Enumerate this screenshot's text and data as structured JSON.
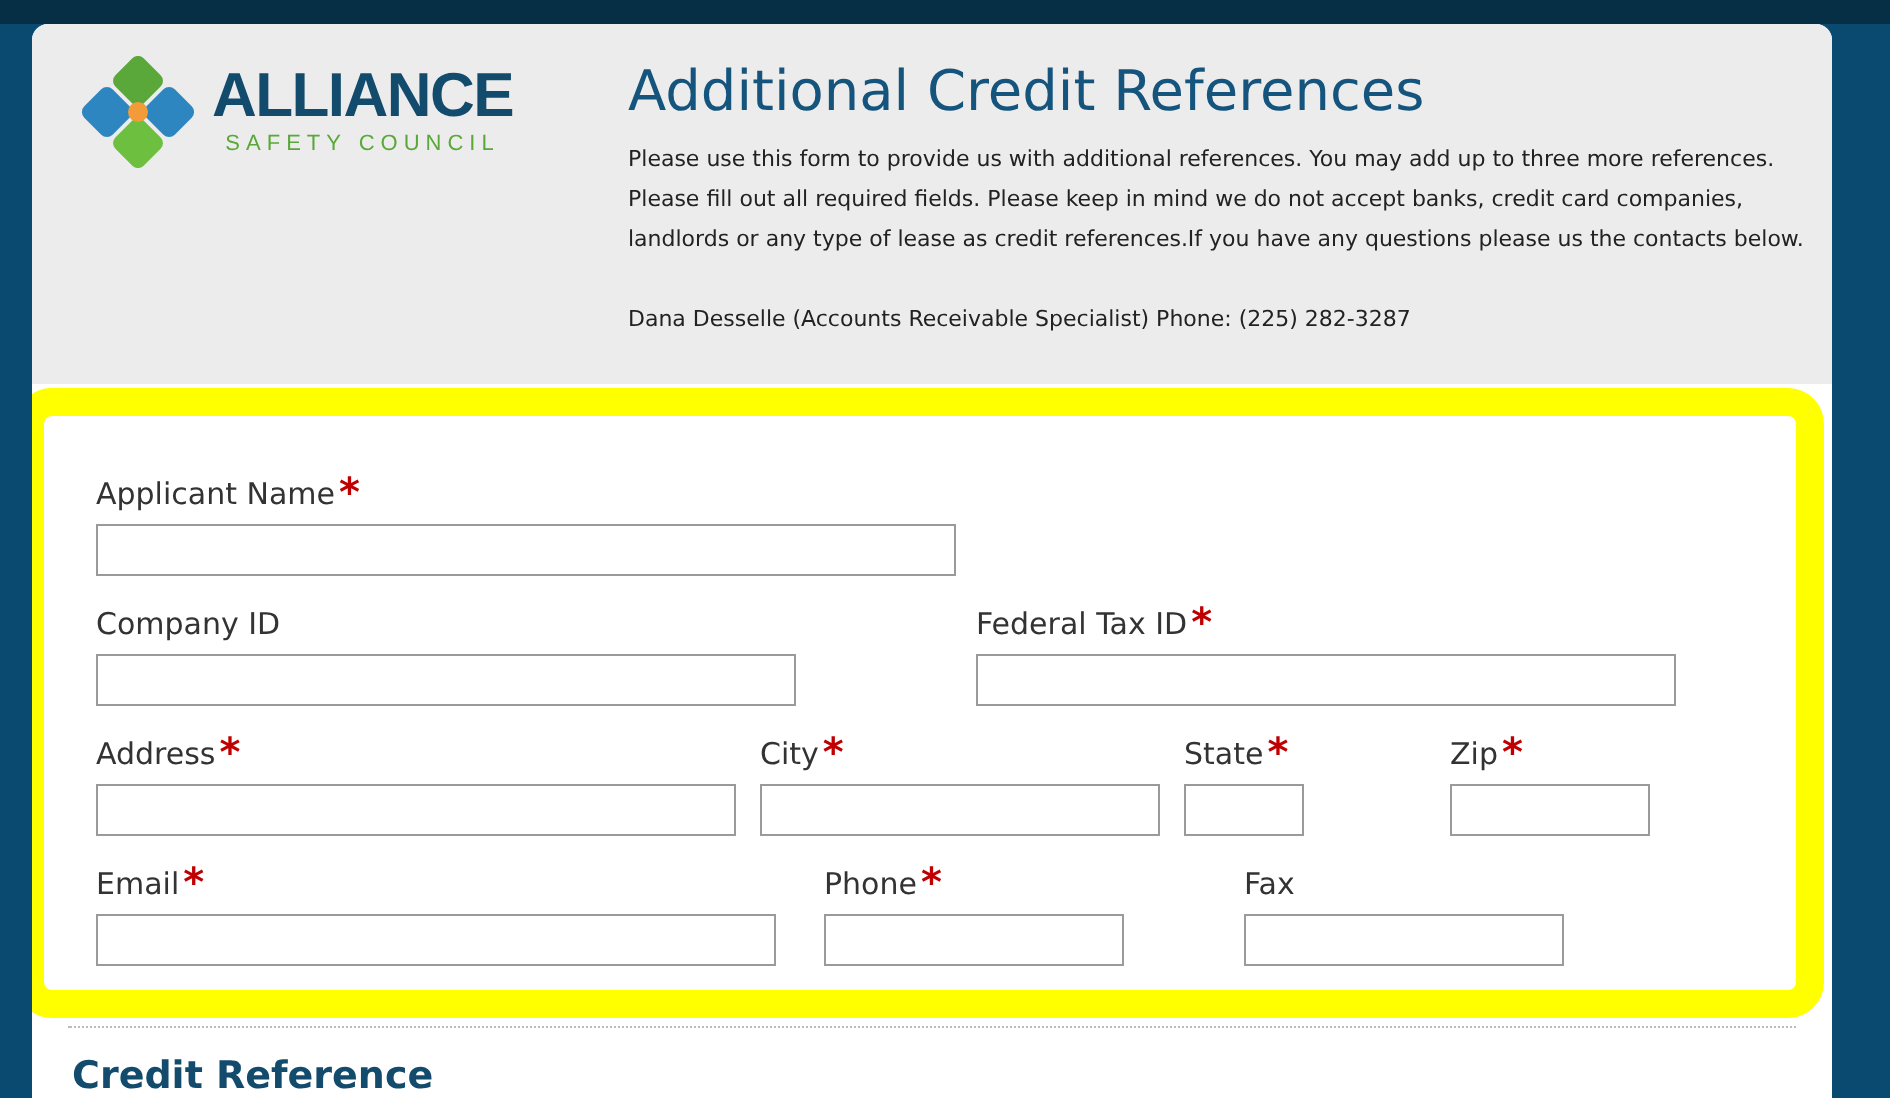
{
  "logo": {
    "name": "ALLIANCE",
    "tagline": "SAFETY COUNCIL"
  },
  "title": "Additional Credit References",
  "intro": [
    "Please use this form to provide us with additional references. You may add up to three more references.",
    "Please fill out all required fields. Please keep in mind we do not accept banks, credit card companies,",
    "landlords or any type of lease as credit references.If you have any questions please us the contacts below."
  ],
  "contact": "Dana Desselle (Accounts Receivable Specialist) Phone: (225) 282-3287",
  "form_rows": [
    [
      {
        "label": "Applicant Name",
        "required": true
      }
    ],
    [
      {
        "label": "Company ID",
        "required": false
      },
      {
        "label": "Federal Tax ID",
        "required": true
      }
    ],
    [
      {
        "label": "Address",
        "required": true
      },
      {
        "label": "City",
        "required": true
      },
      {
        "label": "State",
        "required": true
      },
      {
        "label": "Zip",
        "required": true
      }
    ],
    [
      {
        "label": "Email",
        "required": true
      },
      {
        "label": "Phone",
        "required": true
      },
      {
        "label": "Fax",
        "required": false
      }
    ]
  ],
  "required_mark": "*",
  "section_heading": "Credit Reference"
}
